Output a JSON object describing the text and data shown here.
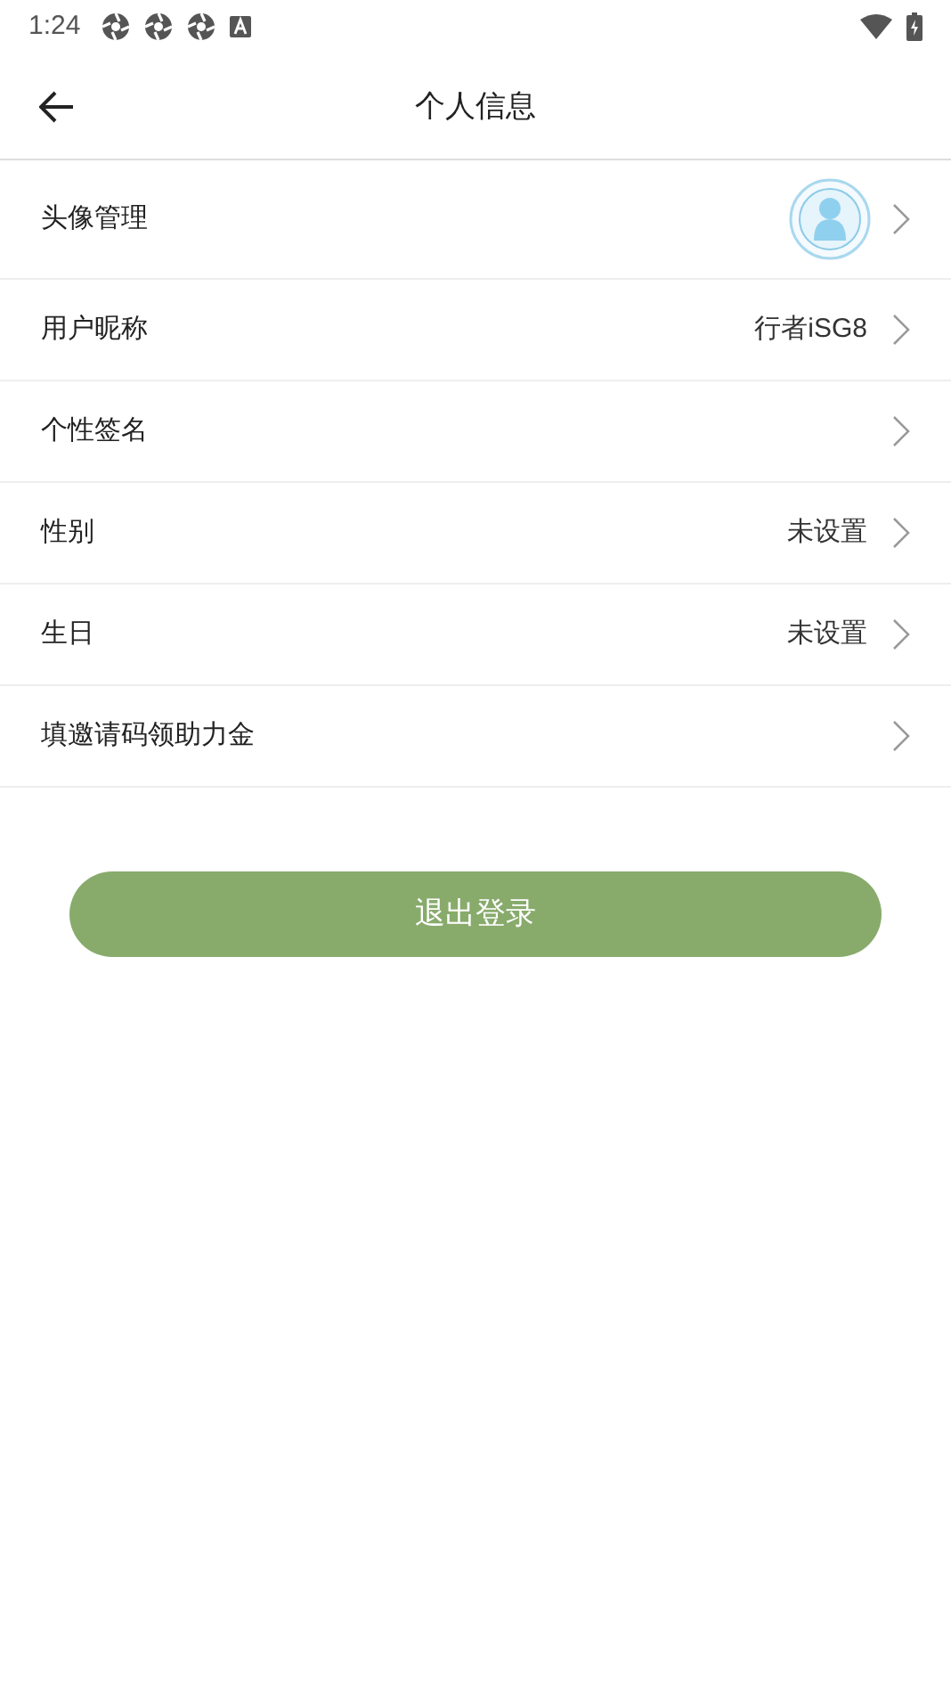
{
  "status_bar": {
    "time": "1:24"
  },
  "header": {
    "title": "个人信息"
  },
  "rows": [
    {
      "kind": "avatar",
      "label": "头像管理"
    },
    {
      "kind": "value",
      "label": "用户昵称",
      "value": "行者iSG8"
    },
    {
      "kind": "plain",
      "label": "个性签名"
    },
    {
      "kind": "value",
      "label": "性别",
      "value": "未设置"
    },
    {
      "kind": "value",
      "label": "生日",
      "value": "未设置"
    },
    {
      "kind": "plain",
      "label": "填邀请码领助力金"
    }
  ],
  "logout_button": {
    "label": "退出登录"
  }
}
